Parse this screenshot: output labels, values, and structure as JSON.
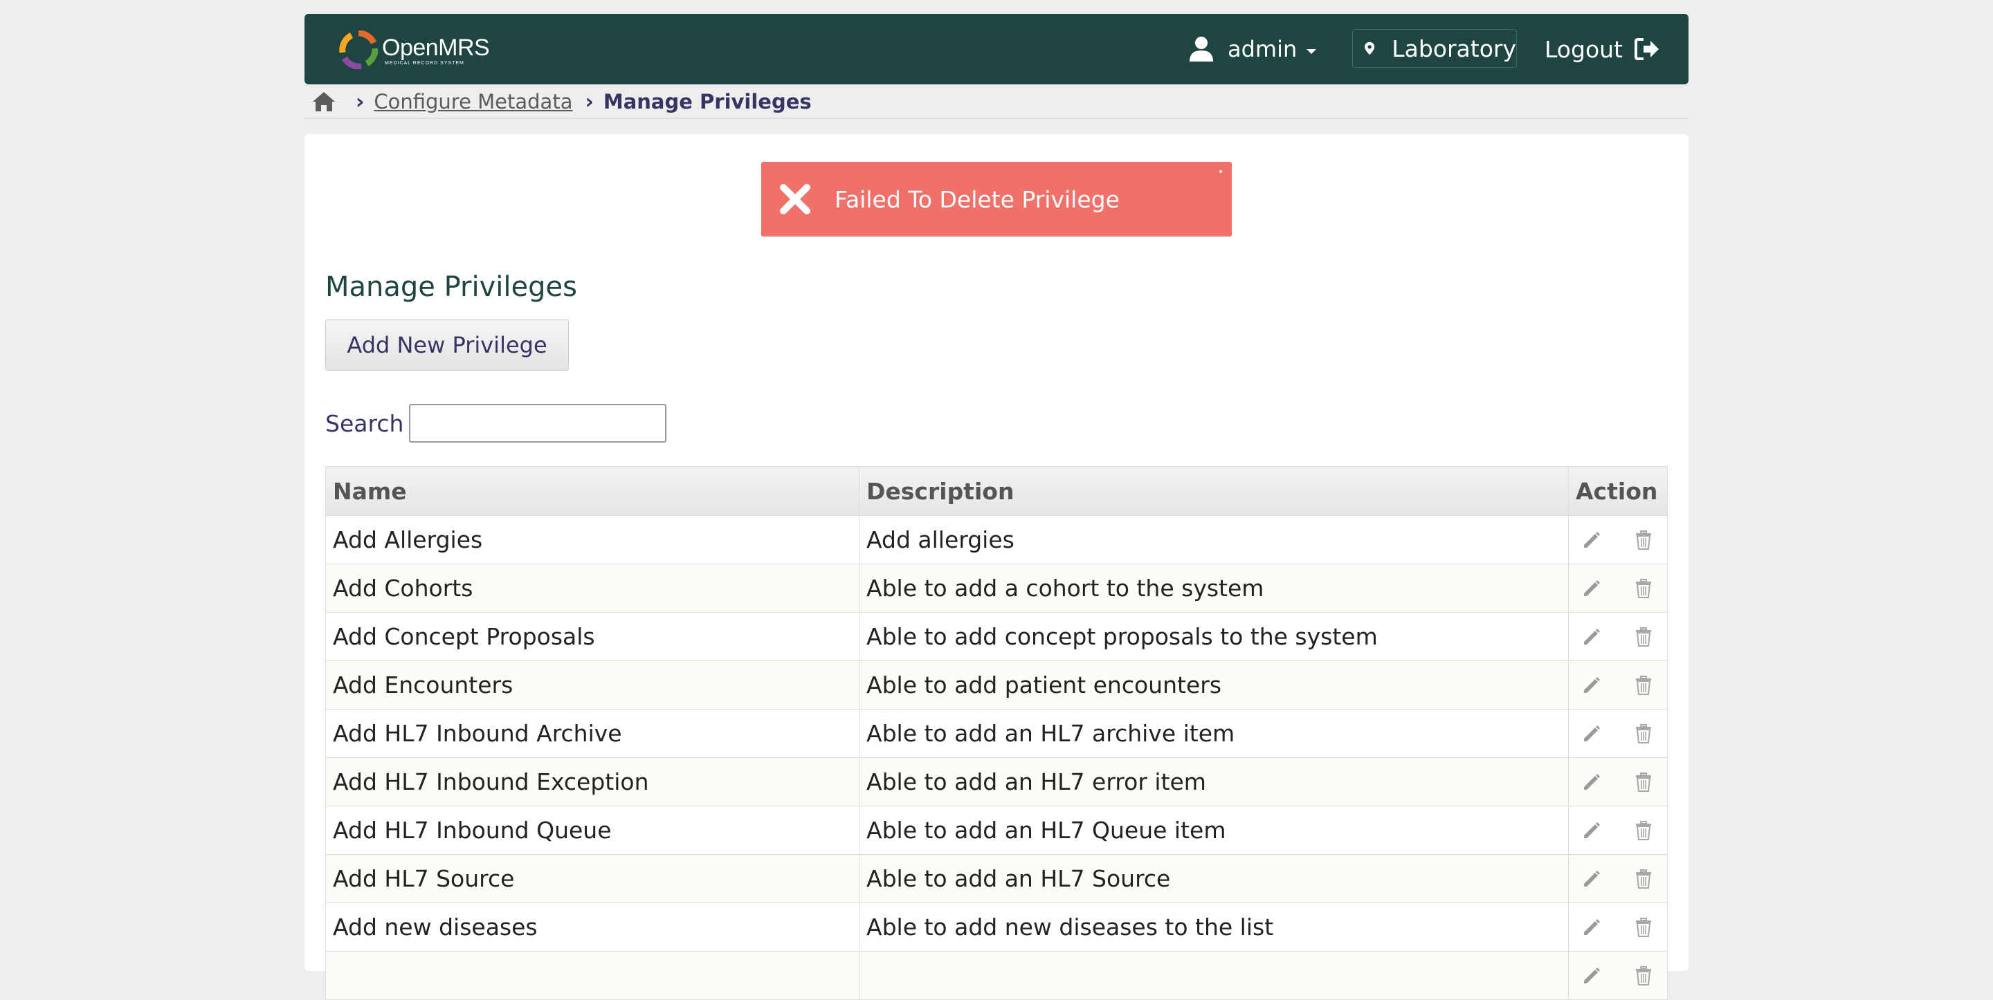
{
  "header": {
    "logo_text": "OpenMRS",
    "logo_subtitle": "MEDICAL RECORD SYSTEM",
    "user": "admin",
    "location": "Laboratory",
    "logout": "Logout"
  },
  "breadcrumb": {
    "link": "Configure Metadata",
    "current": "Manage Privileges"
  },
  "alert": {
    "message": "Failed To Delete Privilege"
  },
  "page": {
    "title": "Manage Privileges",
    "add_button": "Add New Privilege",
    "search_label": "Search",
    "search_value": ""
  },
  "table": {
    "columns": [
      "Name",
      "Description",
      "Action"
    ],
    "rows": [
      {
        "name": "Add Allergies",
        "description": "Add allergies"
      },
      {
        "name": "Add Cohorts",
        "description": "Able to add a cohort to the system"
      },
      {
        "name": "Add Concept Proposals",
        "description": "Able to add concept proposals to the system"
      },
      {
        "name": "Add Encounters",
        "description": "Able to add patient encounters"
      },
      {
        "name": "Add HL7 Inbound Archive",
        "description": "Able to add an HL7 archive item"
      },
      {
        "name": "Add HL7 Inbound Exception",
        "description": "Able to add an HL7 error item"
      },
      {
        "name": "Add HL7 Inbound Queue",
        "description": "Able to add an HL7 Queue item"
      },
      {
        "name": "Add HL7 Source",
        "description": "Able to add an HL7 Source"
      },
      {
        "name": "Add new diseases",
        "description": "Able to add new diseases to the list"
      },
      {
        "name": "",
        "description": ""
      }
    ]
  },
  "colors": {
    "header_bg": "#1e4541",
    "alert_bg": "#f0706a",
    "text": "#363463"
  }
}
